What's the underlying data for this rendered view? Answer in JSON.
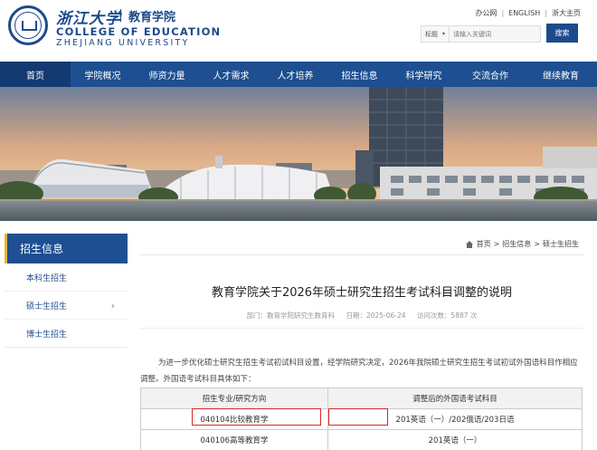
{
  "header": {
    "logo_cn": "浙江大学",
    "college_cn": "教育学院",
    "college_en": "COLLEGE OF EDUCATION",
    "university_en": "ZHEJIANG UNIVERSITY",
    "top_links": [
      "办公网",
      "ENGLISH",
      "浙大主页"
    ],
    "search": {
      "select_label": "标题",
      "placeholder": "请输入关键词",
      "button_label": "搜索"
    }
  },
  "nav": {
    "items": [
      "首页",
      "学院概况",
      "师资力量",
      "人才需求",
      "人才培养",
      "招生信息",
      "科学研究",
      "交流合作",
      "继续教育"
    ],
    "active_index": 0
  },
  "sidebar": {
    "title": "招生信息",
    "items": [
      "本科生招生",
      "硕士生招生",
      "博士生招生"
    ]
  },
  "breadcrumb": [
    "首页",
    "招生信息",
    "硕士生招生"
  ],
  "article": {
    "title": "教育学院关于2026年硕士研究生招生考试科目调整的说明",
    "meta": {
      "department": "部门：教育学院研究生教育科",
      "date": "日期：2025-06-24",
      "views": "访问次数：5887 次"
    },
    "paragraph": "为进一步优化硕士研究生招生考试初试科目设置，经学院研究决定，2026年我院硕士研究生招生考试初试外国语科目作相应调整。外国语考试科目具体如下：",
    "table": {
      "headers": [
        "招生专业/研究方向",
        "调整后的外国语考试科目"
      ],
      "rows": [
        [
          "040104比较教育学",
          "201英语（一）/202俄语/203日语"
        ],
        [
          "040106高等教育学",
          "201英语（一）"
        ]
      ]
    }
  },
  "colors": {
    "brand": "#1d4f91",
    "highlight": "#d42a2a"
  }
}
